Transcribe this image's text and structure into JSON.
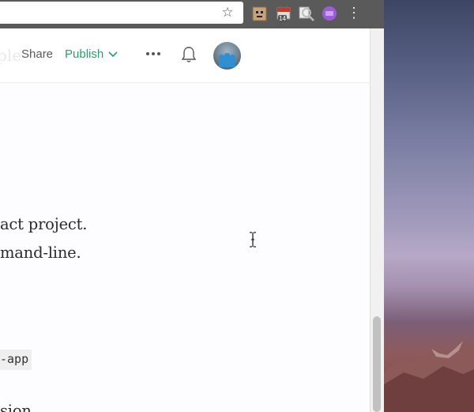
{
  "browser": {
    "omnibox_star": "☆",
    "extensions": [
      {
        "name": "pixel-face-extension"
      },
      {
        "name": "calendar-extension",
        "badge": "14"
      },
      {
        "name": "search-extension"
      },
      {
        "name": "purple-extension"
      }
    ],
    "menu_glyph": "⋮"
  },
  "header": {
    "ghost_title": "ple",
    "share_label": "Share",
    "publish_label": "Publish",
    "more_glyph": "•••"
  },
  "article": {
    "line1": "act project.",
    "line2": "mand-line.",
    "code": "-app",
    "line4": "sion"
  },
  "colors": {
    "publish": "#2f9b6d",
    "toolbar": "#5a5a5a"
  }
}
